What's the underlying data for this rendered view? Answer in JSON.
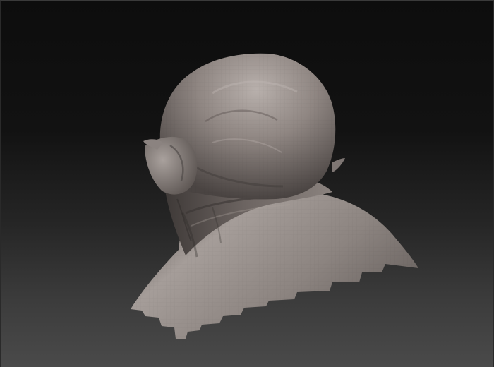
{
  "viewport": {
    "background_top": "#0d0d0d",
    "background_bottom": "#4a4a4a",
    "model_base_color": "#8f8682",
    "model_highlight_color": "#b8b0ac",
    "model_shadow_color": "#3e3937"
  }
}
